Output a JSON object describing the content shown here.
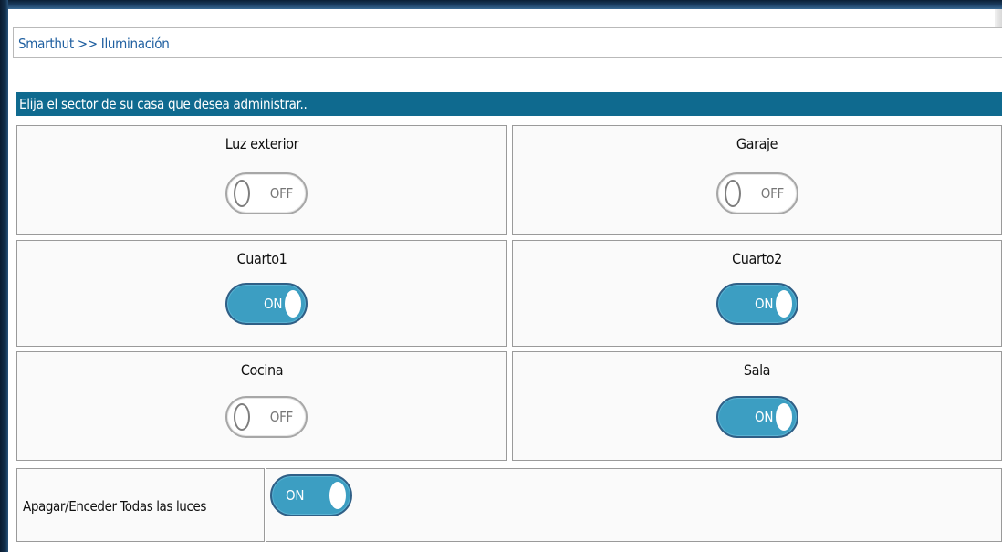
{
  "breadcrumb": "Smarthut >> Iluminación",
  "section_header": "Elija el sector de su casa que desea administrar..",
  "sectors": [
    {
      "name": "Luz exterior",
      "state": "OFF"
    },
    {
      "name": "Garaje",
      "state": "OFF"
    },
    {
      "name": "Cuarto1",
      "state": "ON"
    },
    {
      "name": "Cuarto2",
      "state": "ON"
    },
    {
      "name": "Cocina",
      "state": "OFF"
    },
    {
      "name": "Sala",
      "state": "ON"
    }
  ],
  "master": {
    "label": "Apagar/Enceder Todas las luces",
    "state": "ON"
  },
  "colors": {
    "header_bg": "#0f6a8f",
    "toggle_on": "#3c9ec2",
    "breadcrumb_link": "#1f5fa0"
  }
}
